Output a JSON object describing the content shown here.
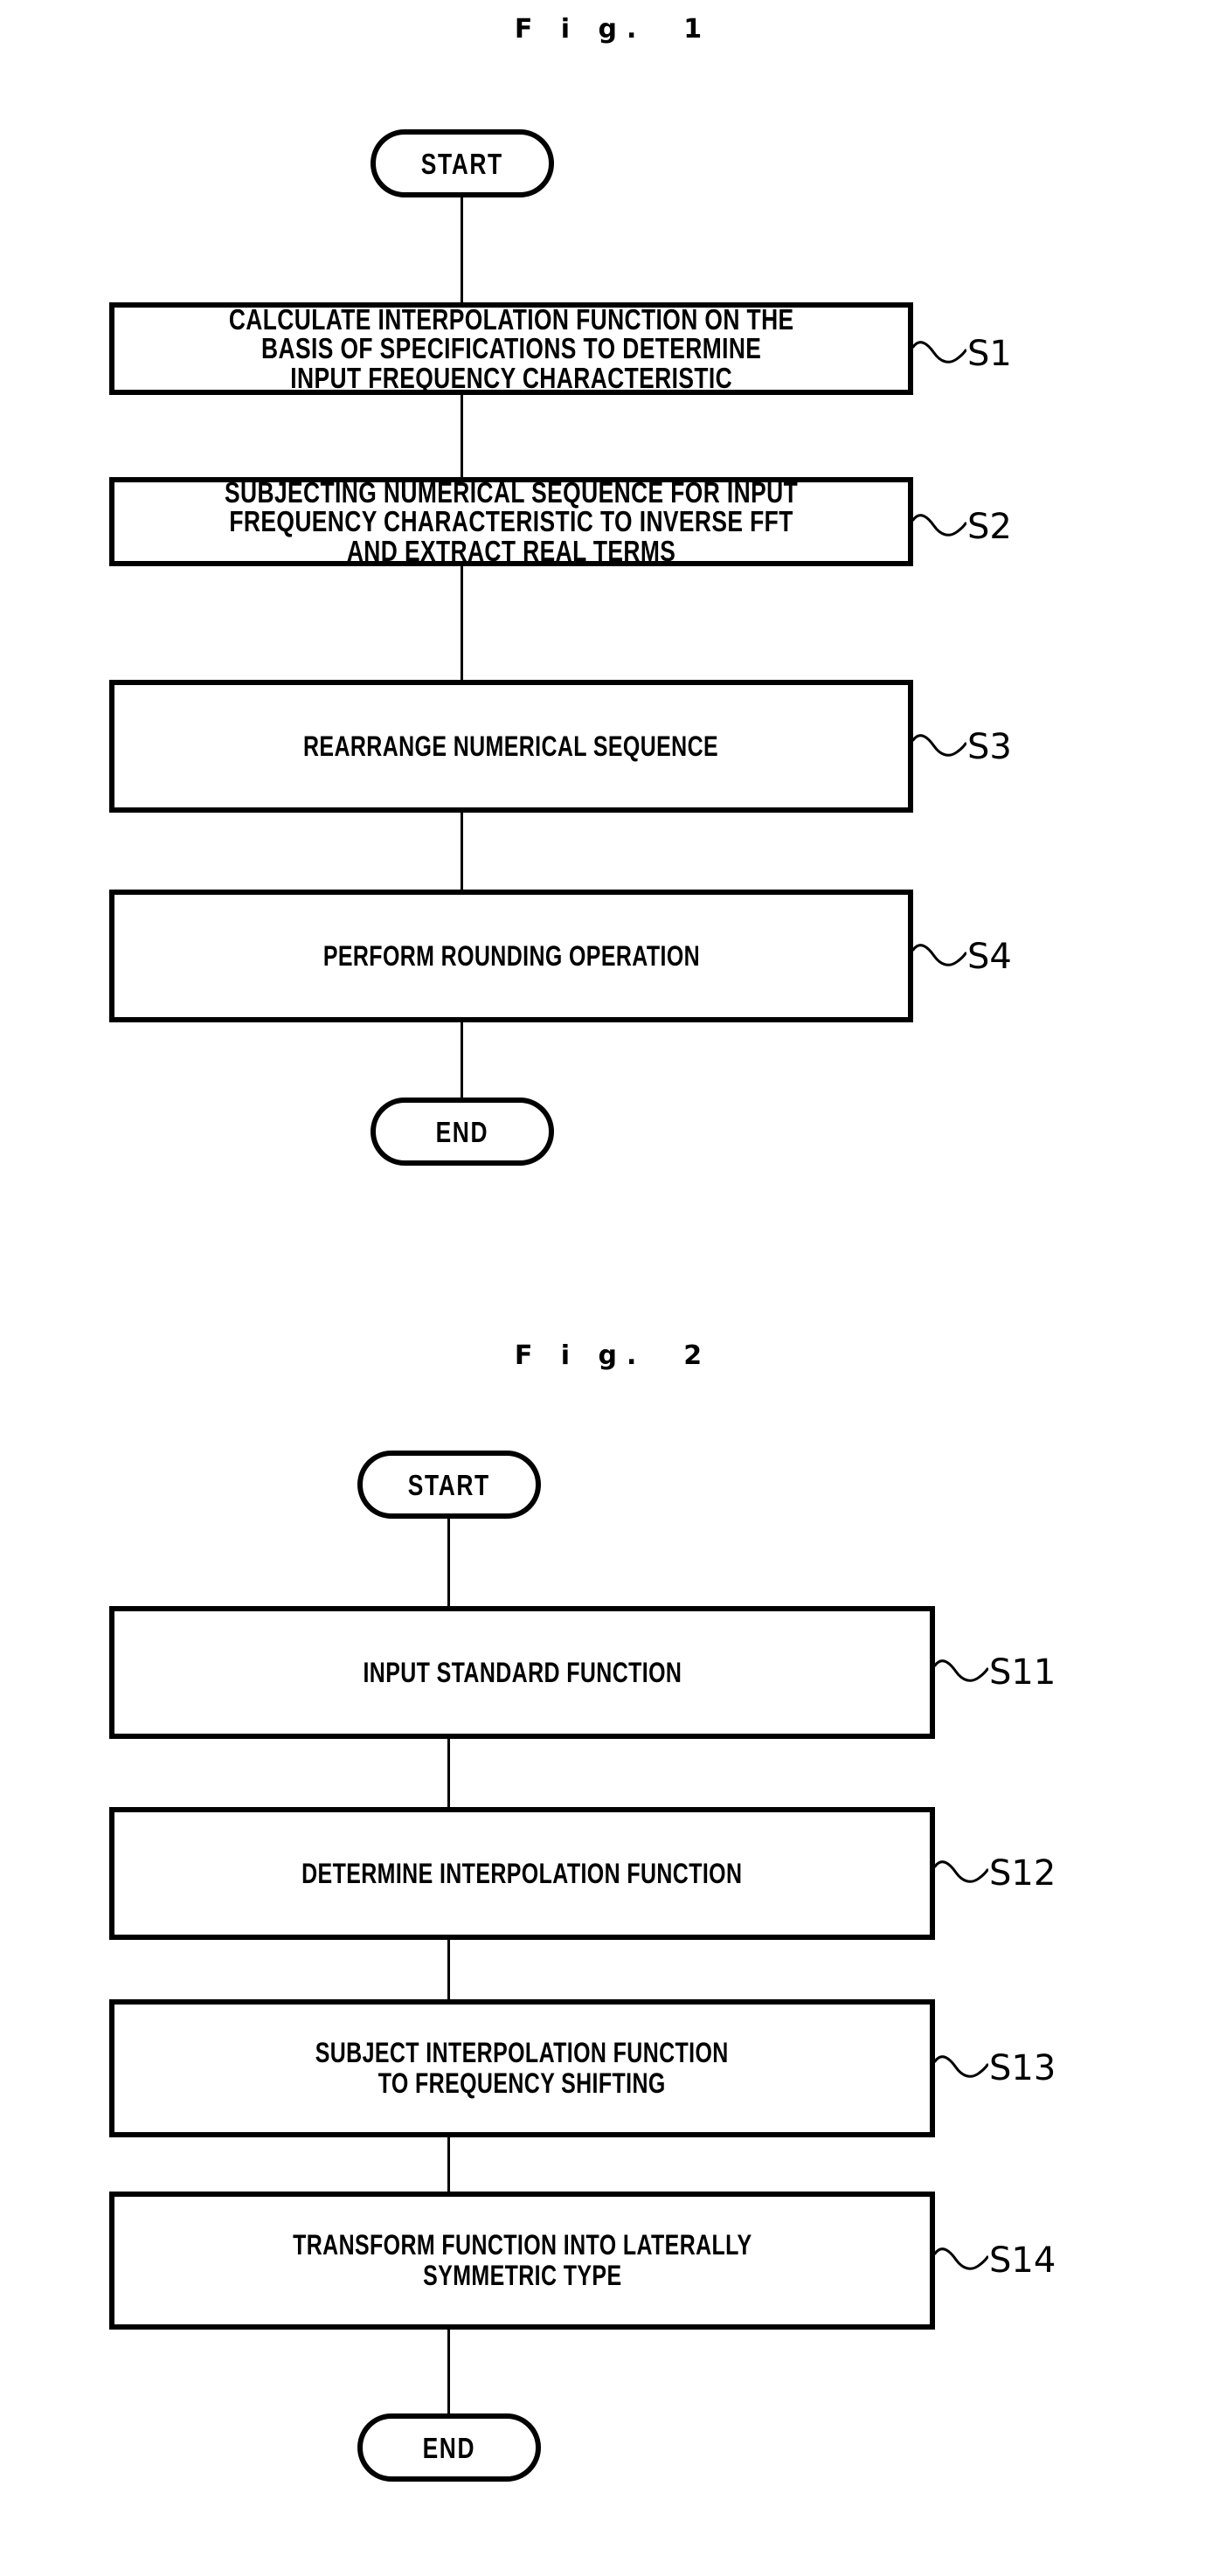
{
  "figures": [
    {
      "title": "F i g.  1",
      "start_label": "START",
      "end_label": "END",
      "steps": [
        {
          "id": "S1",
          "text": "CALCULATE INTERPOLATION FUNCTION ON THE\nBASIS OF SPECIFICATIONS TO DETERMINE\nINPUT FREQUENCY CHARACTERISTIC"
        },
        {
          "id": "S2",
          "text": "SUBJECTING NUMERICAL SEQUENCE FOR INPUT\nFREQUENCY CHARACTERISTIC TO INVERSE FFT\nAND EXTRACT REAL TERMS"
        },
        {
          "id": "S3",
          "text": "REARRANGE NUMERICAL SEQUENCE"
        },
        {
          "id": "S4",
          "text": "PERFORM ROUNDING OPERATION"
        }
      ]
    },
    {
      "title": "F i g.  2",
      "start_label": "START",
      "end_label": "END",
      "steps": [
        {
          "id": "S11",
          "text": "INPUT STANDARD FUNCTION"
        },
        {
          "id": "S12",
          "text": "DETERMINE INTERPOLATION FUNCTION"
        },
        {
          "id": "S13",
          "text": "SUBJECT INTERPOLATION FUNCTION\nTO FREQUENCY SHIFTING"
        },
        {
          "id": "S14",
          "text": "TRANSFORM FUNCTION INTO LATERALLY\nSYMMETRIC TYPE"
        }
      ]
    }
  ],
  "colors": {
    "ink": "#000000",
    "paper": "#ffffff"
  }
}
